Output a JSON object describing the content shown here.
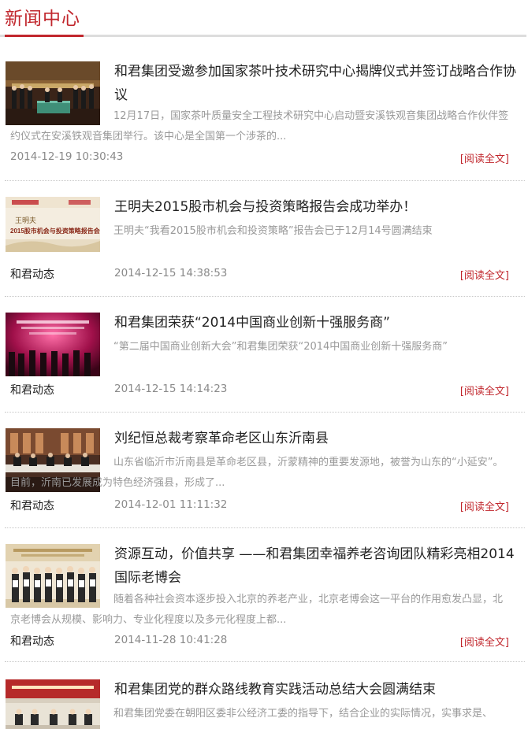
{
  "section": {
    "title": "新闻中心"
  },
  "articles": [
    {
      "title": "和君集团受邀参加国家茶叶技术研究中心揭牌仪式并签订战略合作协议",
      "summary": "12月17日，国家茶叶质量安全工程技术研究中心启动暨安溪铁观音集团战略合作伙伴签约仪式在安溪铁观音集团举行。该中心是全国第一个涉茶的...",
      "source": "",
      "date": "2014-12-19 10:30:43",
      "read_more": "[阅读全文]"
    },
    {
      "title": "王明夫2015股市机会与投资策略报告会成功举办！",
      "summary": "王明夫“我看2015股市机会和投资策略”报告会已于12月14号圆满结束",
      "source": "和君动态",
      "date": "2014-12-15 14:38:53",
      "read_more": "[阅读全文]",
      "thumb_text": {
        "line1": "王明夫",
        "line2": "2015股市机会与投资策略报告会"
      }
    },
    {
      "title": "和君集团荣获“2014中国商业创新十强服务商”",
      "summary": "“第二届中国商业创新大会”和君集团荣获“2014中国商业创新十强服务商”",
      "source": "和君动态",
      "date": "2014-12-15 14:14:23",
      "read_more": "[阅读全文]"
    },
    {
      "title": "刘纪恒总裁考察革命老区山东沂南县",
      "summary": "山东省临沂市沂南县是革命老区县，沂蒙精神的重要发源地，被誉为山东的“小延安”。目前，沂南已发展成为特色经济强县，形成了...",
      "source": "和君动态",
      "date": "2014-12-01 11:11:32",
      "read_more": "[阅读全文]"
    },
    {
      "title": "资源互动，价值共享 ——和君集团幸福养老咨询团队精彩亮相2014国际老博会",
      "summary": "随着各种社会资本逐步投入北京的养老产业，北京老博会这一平台的作用愈发凸显，北京老博会从规模、影响力、专业化程度以及多元化程度上都...",
      "source": "和君动态",
      "date": "2014-11-28 10:41:28",
      "read_more": "[阅读全文]"
    },
    {
      "title": "和君集团党的群众路线教育实践活动总结大会圆满结束",
      "summary": "和君集团党委在朝阳区委非公经济工委的指导下，结合企业的实际情况，实事求是、",
      "source": "",
      "date": "",
      "read_more": ""
    }
  ],
  "colors": {
    "accent": "#c1272d",
    "muted": "#999999",
    "title": "#222222"
  }
}
